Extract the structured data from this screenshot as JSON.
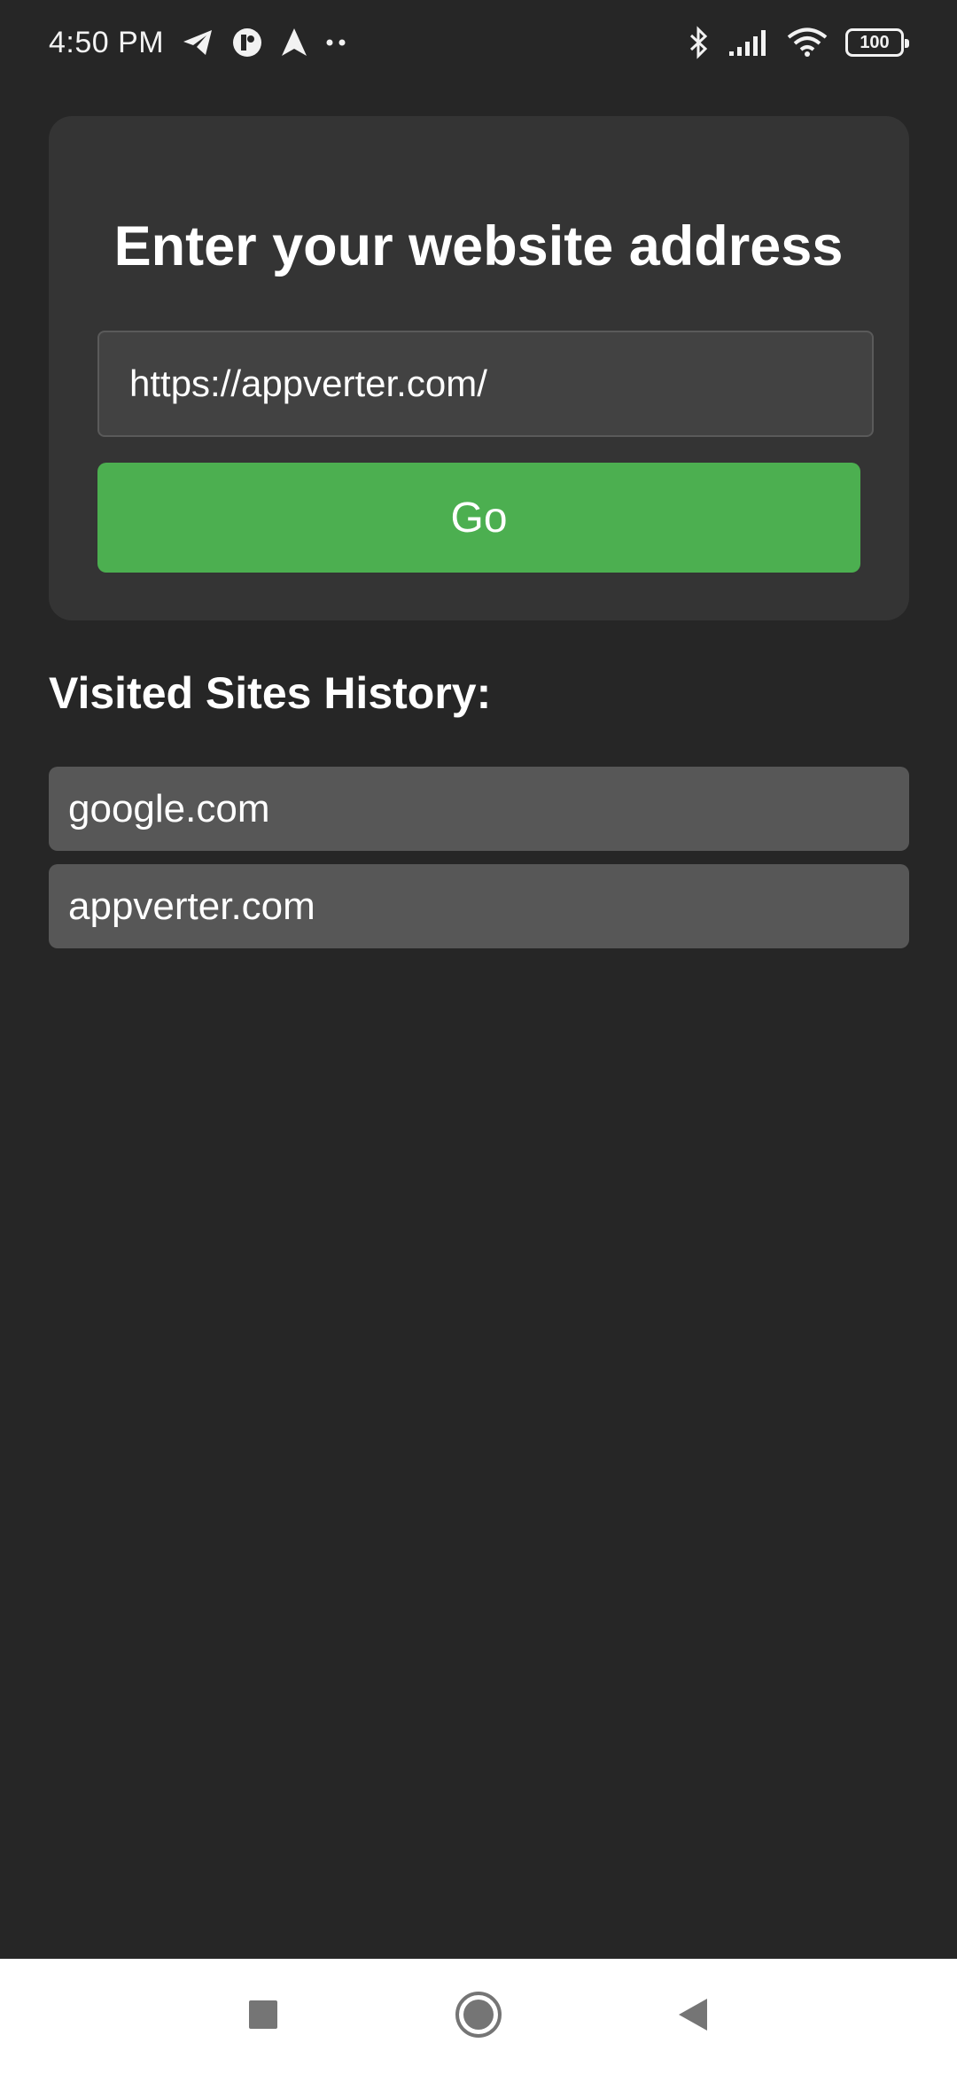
{
  "status_bar": {
    "time": "4:50 PM",
    "battery_level": "100",
    "left_icons": [
      "telegram-icon",
      "app-icon",
      "navigation-icon",
      "more-dots-icon"
    ],
    "right_icons": [
      "bluetooth-icon",
      "signal-icon",
      "wifi-icon",
      "battery-icon"
    ]
  },
  "card": {
    "title": "Enter your website address",
    "url_value": "https://appverter.com/",
    "go_label": "Go"
  },
  "history": {
    "title": "Visited Sites History:",
    "items": [
      "google.com",
      "appverter.com"
    ]
  },
  "nav_bar": {
    "icons": [
      "recents-square-icon",
      "home-circle-icon",
      "back-triangle-icon"
    ]
  },
  "colors": {
    "background": "#262626",
    "card": "#343434",
    "input": "#424242",
    "accent_green": "#4caf50",
    "history_item": "#575757",
    "nav_bar": "#ffffff"
  }
}
